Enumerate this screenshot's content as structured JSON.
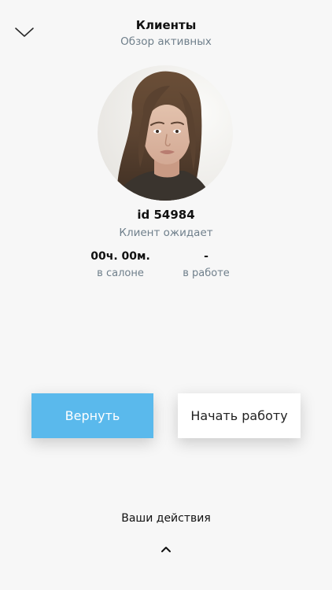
{
  "header": {
    "title": "Клиенты",
    "subtitle": "Обзор активных"
  },
  "icons": {
    "collapse": "chevron-down-icon",
    "expand": "chevron-up-icon"
  },
  "client": {
    "id_label": "id 54984",
    "status": "Клиент ожидает",
    "stats": [
      {
        "value": "00ч. 00м.",
        "label": "в салоне"
      },
      {
        "value": "-",
        "label": "в работе"
      }
    ]
  },
  "buttons": {
    "return_label": "Вернуть",
    "start_label": "Начать работу"
  },
  "footer": {
    "actions_label": "Ваши действия"
  },
  "colors": {
    "accent": "#5ab9ec",
    "background": "#f7f7f7",
    "muted_text": "#6f7f8b"
  }
}
